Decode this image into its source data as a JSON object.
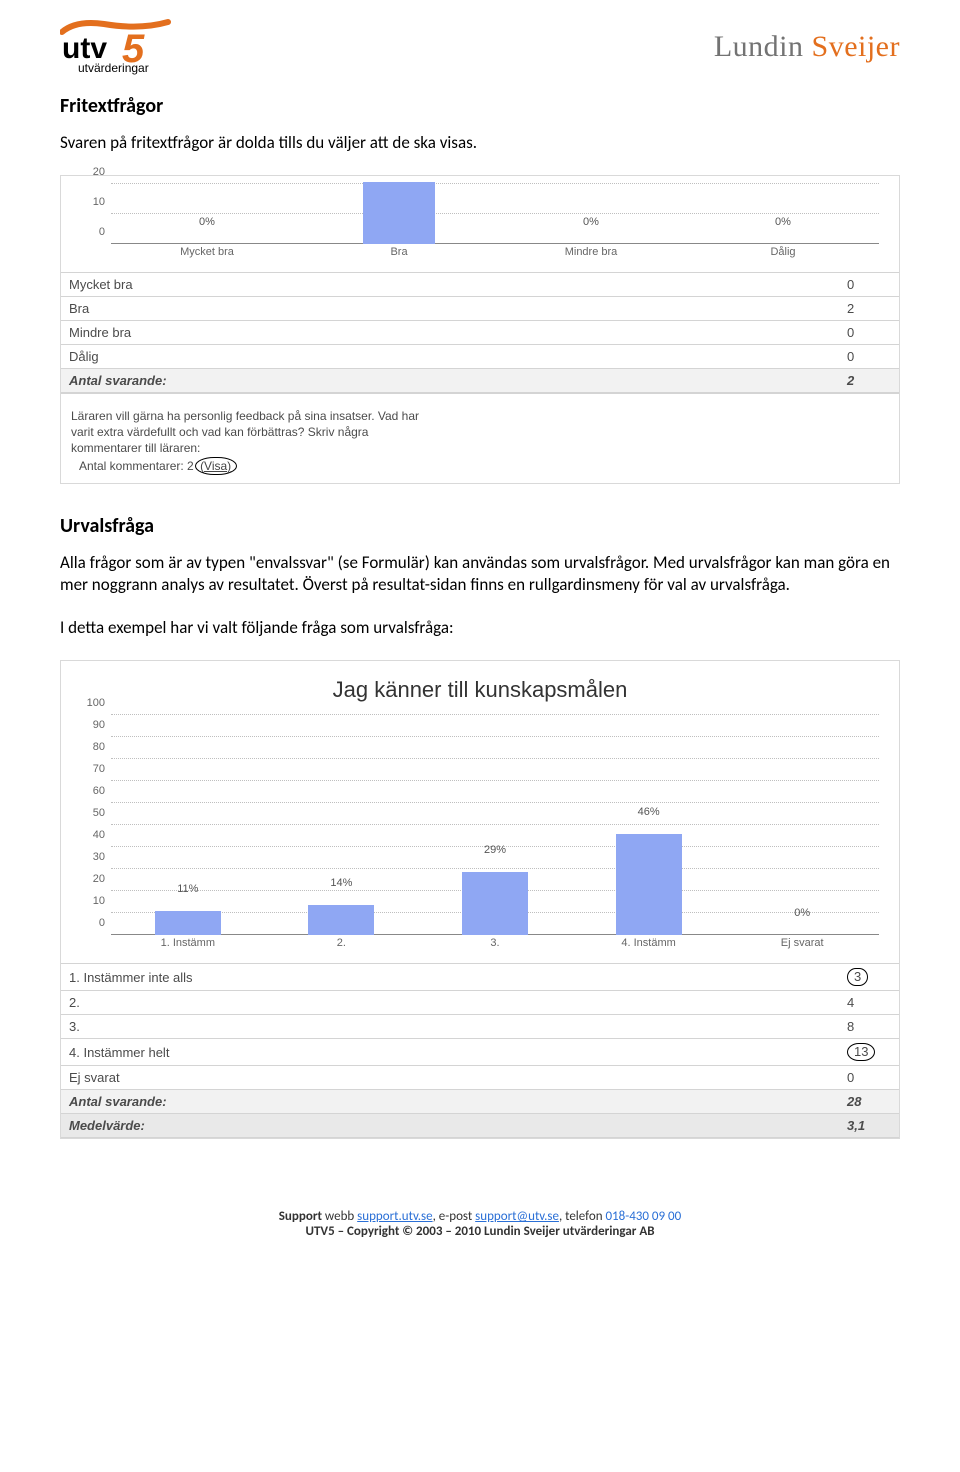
{
  "logos": {
    "left_main": "utv",
    "left_digit": "5",
    "left_sub": "utvärderingar",
    "right_a": "Lundin ",
    "right_b": "Sveijer"
  },
  "section1": {
    "heading": "Fritextfrågor",
    "para": "Svaren på fritextfrågor är dolda tills du väljer att de ska visas."
  },
  "panel1": {
    "yticks": [
      "20",
      "10",
      "0"
    ],
    "categories": [
      "Mycket bra",
      "Bra",
      "Mindre bra",
      "Dålig"
    ],
    "pct_labels": [
      "0%",
      "",
      "0%",
      "0%"
    ],
    "rows": [
      {
        "label": "Mycket bra",
        "value": "0"
      },
      {
        "label": "Bra",
        "value": "2"
      },
      {
        "label": "Mindre bra",
        "value": "0"
      },
      {
        "label": "Dålig",
        "value": "0"
      }
    ],
    "total_label": "Antal svarande:",
    "total_value": "2",
    "freeform": "Läraren vill gärna ha personlig feedback på sina insatser. Vad har varit extra värdefullt och vad kan förbättras? Skriv några kommentarer till läraren:",
    "comment_count_label": "Antal kommentarer: 2",
    "visa": "(Visa)"
  },
  "section2": {
    "heading": "Urvalsfråga",
    "para": "Alla frågor som är av typen \"envalssvar\" (se Formulär) kan användas som urvalsfrågor. Med urvalsfrågor kan man göra en mer noggrann analys av resultatet. Överst på resultat-sidan finns en rullgardinsmeny för val av urvalsfråga.",
    "para2": "I detta exempel har vi valt följande fråga som urvalsfråga:"
  },
  "panel2": {
    "title": "Jag känner till kunskapsmålen",
    "yticks": [
      "100",
      "90",
      "80",
      "70",
      "60",
      "50",
      "40",
      "30",
      "20",
      "10",
      "0"
    ],
    "categories": [
      "1. Instämm",
      "2.",
      "3.",
      "4. Instämm",
      "Ej svarat"
    ],
    "pct_labels": [
      "11%",
      "14%",
      "29%",
      "46%",
      "0%"
    ],
    "pct_values": [
      11,
      14,
      29,
      46,
      0
    ],
    "rows": [
      {
        "label": "1. Instämmer inte alls",
        "value": "3",
        "circle": true
      },
      {
        "label": "2.",
        "value": "4"
      },
      {
        "label": "3.",
        "value": "8"
      },
      {
        "label": "4. Instämmer helt",
        "value": "13",
        "circle": true
      },
      {
        "label": "Ej svarat",
        "value": "0"
      }
    ],
    "total_label": "Antal svarande:",
    "total_value": "28",
    "mean_label": "Medelvärde:",
    "mean_value": "3,1"
  },
  "chart_data": [
    {
      "type": "bar",
      "title": "",
      "categories": [
        "Mycket bra",
        "Bra",
        "Mindre bra",
        "Dålig"
      ],
      "values": [
        0,
        100,
        0,
        0
      ],
      "value_labels": [
        "0%",
        "",
        "0%",
        "0%"
      ],
      "ylabel": "",
      "xlabel": "",
      "ylim": [
        0,
        20
      ],
      "note": "Y-axis ticks shown are 0/10/20; bar heights represent percent of 2 respondents (only visible bar is 'Bra')."
    },
    {
      "type": "bar",
      "title": "Jag känner till kunskapsmålen",
      "categories": [
        "1. Instämm",
        "2.",
        "3.",
        "4. Instämm",
        "Ej svarat"
      ],
      "values": [
        11,
        14,
        29,
        46,
        0
      ],
      "ylabel": "",
      "xlabel": "",
      "ylim": [
        0,
        100
      ]
    }
  ],
  "footer": {
    "support_label": "Support",
    "webb_label": " webb ",
    "webb_link_text": "support.utv.se",
    "epost_label": ", e-post ",
    "epost_link_text": "support@utv.se",
    "tel_label": ", telefon ",
    "tel_value": "018-430 09 00",
    "copyright": "UTV5 – Copyright © 2003 – 2010 Lundin Sveijer utvärderingar AB"
  }
}
